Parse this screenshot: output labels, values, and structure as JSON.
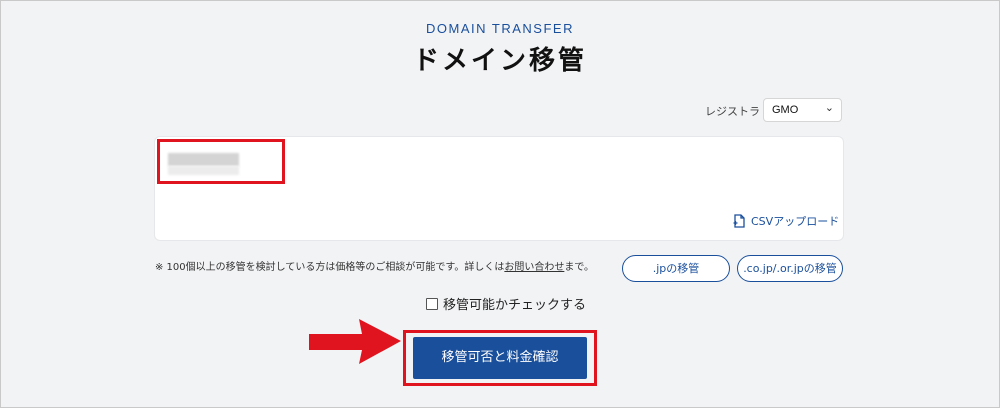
{
  "header": {
    "eyebrow": "DOMAIN TRANSFER",
    "title": "ドメイン移管"
  },
  "registrar": {
    "label": "レジストラ",
    "selected": "GMO"
  },
  "domain_input": {
    "value": "",
    "csv_upload_label": "CSVアップロード"
  },
  "note": {
    "prefix": "※ 100個以上の移管を検討している方は価格等のご相談が可能です。詳しくは",
    "link": "お問い合わせ",
    "suffix": "まで。"
  },
  "buttons": {
    "jp_transfer": ".jpの移管",
    "cojp_transfer": ".co.jp/.or.jpの移管",
    "submit": "移管可否と料金確認"
  },
  "checkbox": {
    "label": "移管可能かチェックする",
    "checked": false
  },
  "colors": {
    "brand_blue": "#1a4f9c",
    "highlight_red": "#e0141e",
    "background": "#f2f3f5"
  }
}
